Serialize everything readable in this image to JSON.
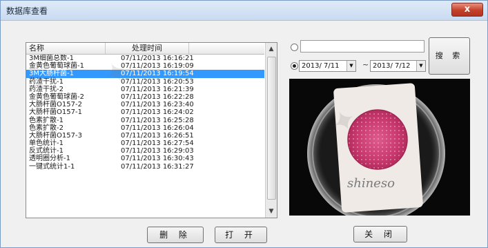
{
  "window": {
    "title": "数据库查看",
    "close_label": "x"
  },
  "list": {
    "columns": [
      "名称",
      "处理时间"
    ],
    "rows": [
      {
        "name": "3M细菌总数-1",
        "time": "07/11/2013 16:16:21"
      },
      {
        "name": "金黄色葡萄球菌-1",
        "time": "07/11/2013 16:19:09"
      },
      {
        "name": "3M大肠杆菌-1",
        "time": "07/11/2013 16:19:54",
        "selected": true
      },
      {
        "name": "药渣干扰-1",
        "time": "07/11/2013 16:20:53"
      },
      {
        "name": "药渣干扰-2",
        "time": "07/11/2013 16:21:39"
      },
      {
        "name": "金黄色葡萄球菌-2",
        "time": "07/11/2013 16:22:28"
      },
      {
        "name": "大肠杆菌O157-2",
        "time": "07/11/2013 16:23:40"
      },
      {
        "name": "大肠杆菌O157-1",
        "time": "07/11/2013 16:24:02"
      },
      {
        "name": "色素扩散-1",
        "time": "07/11/2013 16:25:28"
      },
      {
        "name": "色素扩散-2",
        "time": "07/11/2013 16:26:04"
      },
      {
        "name": "大肠杆菌O157-3",
        "time": "07/11/2013 16:26:51"
      },
      {
        "name": "单色统计-1",
        "time": "07/11/2013 16:27:54"
      },
      {
        "name": "反式统计-1",
        "time": "07/11/2013 16:29:03"
      },
      {
        "name": "透明圈分析-1",
        "time": "07/11/2013 16:30:43"
      },
      {
        "name": "一键式统计1-1",
        "time": "07/11/2013 16:31:27"
      }
    ]
  },
  "buttons": {
    "delete": "删 除",
    "open": "打 开",
    "close": "关 闭",
    "search": "搜 索"
  },
  "filter": {
    "text_value": "",
    "date_from": "2013/ 7/11",
    "date_to": "2013/ 7/12",
    "separator": "~"
  },
  "image": {
    "caption": "shineso"
  },
  "colors": {
    "selection": "#3399ff",
    "dish_red": "#d2407a"
  },
  "icons": [
    "scroll-up-arrow-icon",
    "scroll-down-arrow-icon",
    "dropdown-arrow-icon",
    "close-x-icon"
  ]
}
